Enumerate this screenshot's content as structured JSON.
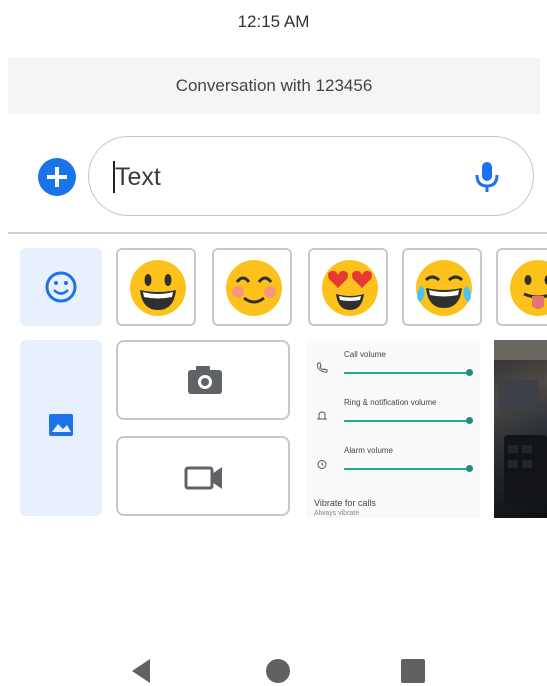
{
  "status_bar": {
    "time": "12:15 AM"
  },
  "conversation": {
    "title": "Conversation with 123456"
  },
  "compose": {
    "placeholder": "Text",
    "add_icon": "plus-circle-icon",
    "mic_icon": "microphone-icon"
  },
  "attachment_tabs": [
    {
      "icon": "smiley-icon",
      "selected": true
    },
    {
      "icon": "image-gallery-icon",
      "selected": true
    }
  ],
  "emojis": [
    {
      "icon": "grinning-face-icon"
    },
    {
      "icon": "smiling-blushing-face-icon"
    },
    {
      "icon": "heart-eyes-face-icon"
    },
    {
      "icon": "tears-of-joy-face-icon"
    },
    {
      "icon": "tongue-out-face-icon"
    }
  ],
  "media_buttons": [
    {
      "icon": "camera-icon"
    },
    {
      "icon": "video-camera-icon"
    }
  ],
  "gallery_thumbnail": {
    "rows": [
      {
        "label": "Call volume",
        "icon": "phone-icon"
      },
      {
        "label": "Ring & notification volume",
        "icon": "bell-icon"
      },
      {
        "label": "Alarm volume",
        "icon": "alarm-clock-icon"
      }
    ],
    "footer_title": "Vibrate for calls",
    "footer_sub": "Always vibrate"
  },
  "nav_bar": {
    "back": "back-triangle-icon",
    "home": "home-circle-icon",
    "recents": "recents-square-icon"
  },
  "colors": {
    "accent": "#1a73e8",
    "tab_bg": "#e8f0fe",
    "slider": "#26a69a"
  }
}
